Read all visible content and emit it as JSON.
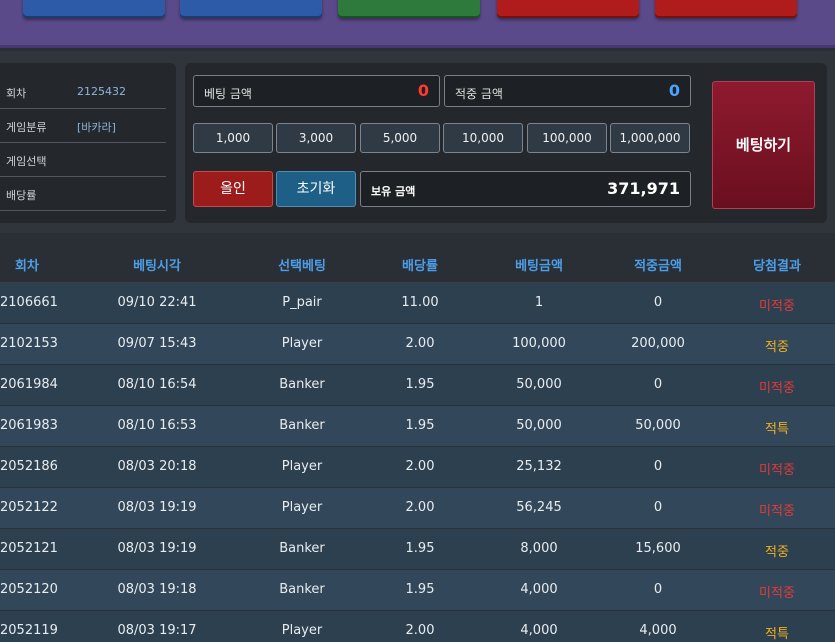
{
  "panel": {
    "info": [
      {
        "key": "회차",
        "value": "2125432"
      },
      {
        "key": "게임분류",
        "value": "[바카라]"
      },
      {
        "key": "게임선택",
        "value": ""
      },
      {
        "key": "배당률",
        "value": ""
      }
    ],
    "bet_amount_label": "베팅 금액",
    "bet_amount_value": "0",
    "win_amount_label": "적중 금액",
    "win_amount_value": "0",
    "chips": [
      "1,000",
      "3,000",
      "5,000",
      "10,000",
      "100,000",
      "1,000,000"
    ],
    "allin_label": "올인",
    "reset_label": "초기화",
    "holding_label": "보유 금액",
    "holding_value": "371,971",
    "bet_button_label": "베팅하기"
  },
  "table": {
    "headers": [
      "회차",
      "베팅시각",
      "선택베팅",
      "배당률",
      "베팅금액",
      "적중금액",
      "당첨결과"
    ],
    "rows": [
      [
        "2106661",
        "09/10 22:41",
        "P_pair",
        "11.00",
        "1",
        "0",
        "미적중"
      ],
      [
        "2102153",
        "09/07 15:43",
        "Player",
        "2.00",
        "100,000",
        "200,000",
        "적중"
      ],
      [
        "2061984",
        "08/10 16:54",
        "Banker",
        "1.95",
        "50,000",
        "0",
        "미적중"
      ],
      [
        "2061983",
        "08/10 16:53",
        "Banker",
        "1.95",
        "50,000",
        "50,000",
        "적특"
      ],
      [
        "2052186",
        "08/03 20:18",
        "Player",
        "2.00",
        "25,132",
        "0",
        "미적중"
      ],
      [
        "2052122",
        "08/03 19:19",
        "Player",
        "2.00",
        "56,245",
        "0",
        "미적중"
      ],
      [
        "2052121",
        "08/03 19:19",
        "Banker",
        "1.95",
        "8,000",
        "15,600",
        "적중"
      ],
      [
        "2052120",
        "08/03 19:18",
        "Banker",
        "1.95",
        "4,000",
        "0",
        "미적중"
      ],
      [
        "2052119",
        "08/03 19:17",
        "Player",
        "2.00",
        "4,000",
        "4,000",
        "적특"
      ]
    ]
  },
  "colors": {
    "lose": "#e23a3a",
    "win": "#f0b020",
    "header_text": "#4d9ee8"
  }
}
